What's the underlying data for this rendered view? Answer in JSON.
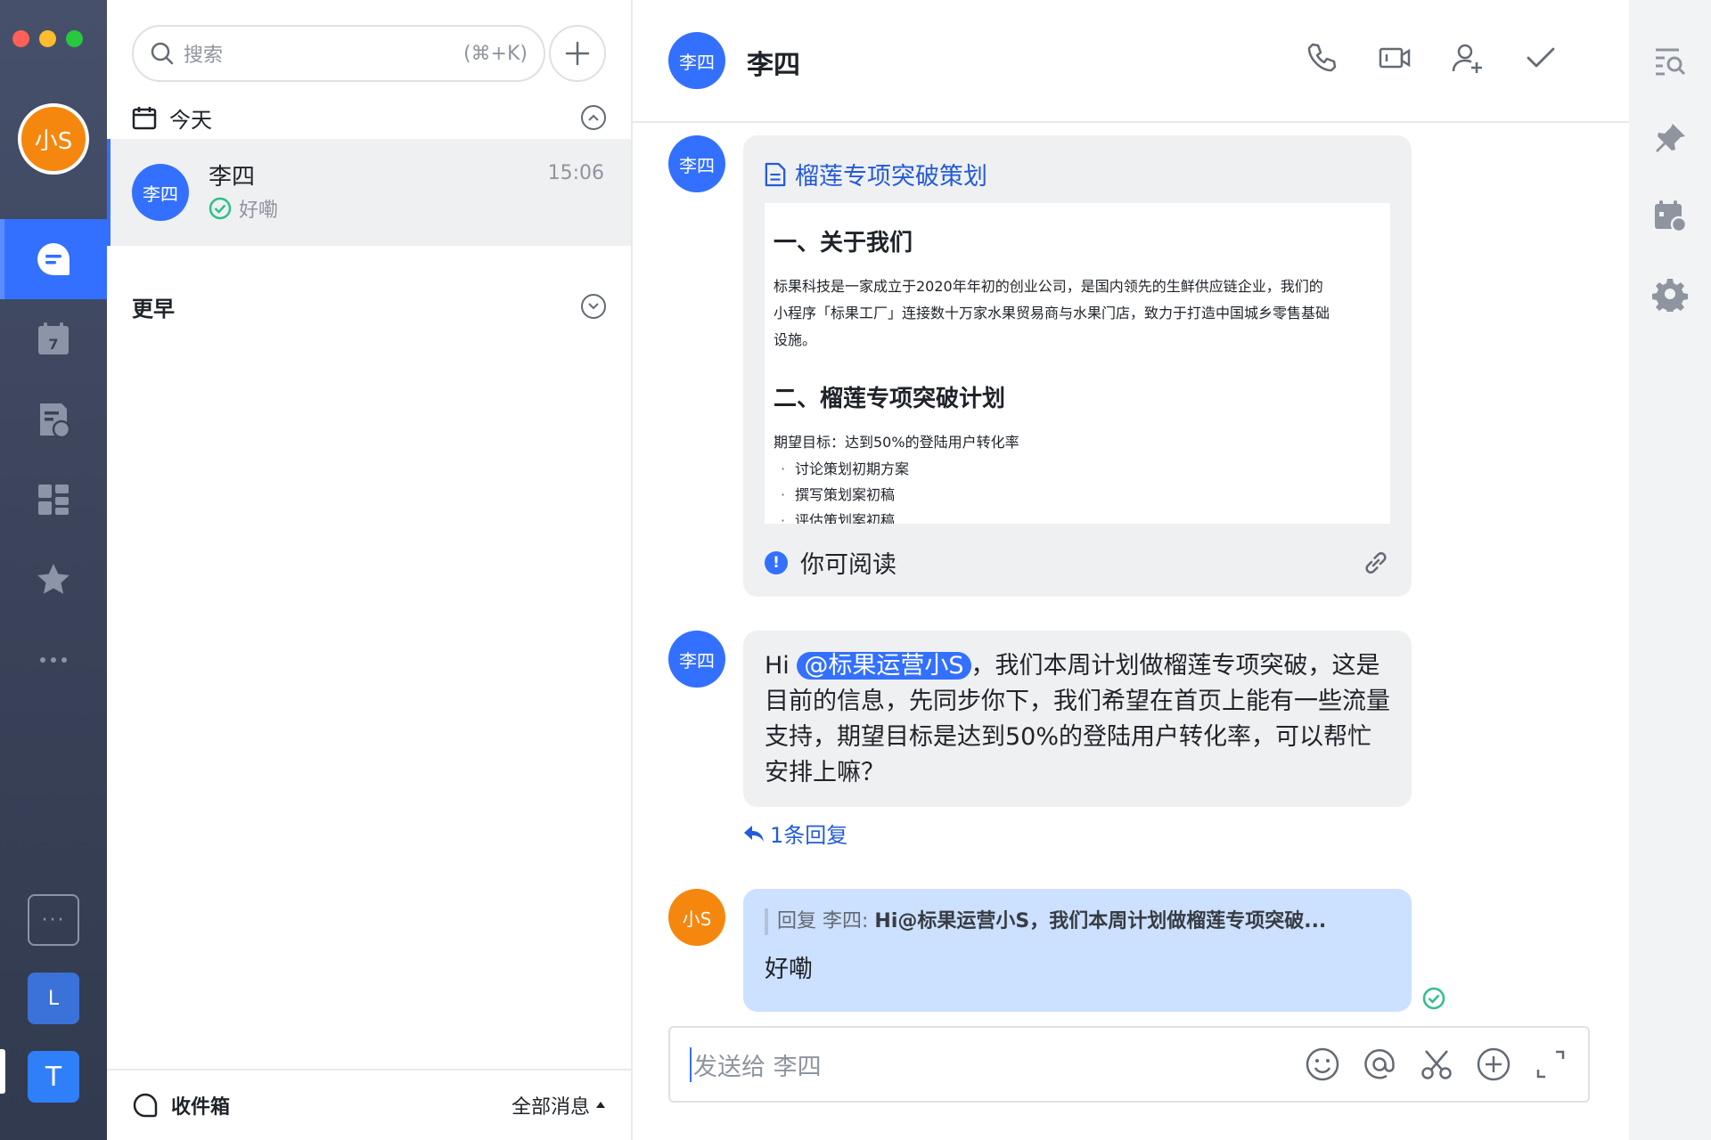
{
  "colors": {
    "accent": "#3370ff",
    "rail_bg": "#3a4259",
    "my_avatar": "#f5870f",
    "read_ok": "#2fbf8a"
  },
  "user": {
    "avatar_text": "小S"
  },
  "nav": {
    "items": [
      {
        "icon": "chat-icon",
        "active": true
      },
      {
        "icon": "calendar-icon",
        "badge": "7"
      },
      {
        "icon": "docs-icon"
      },
      {
        "icon": "apps-icon"
      },
      {
        "icon": "star-icon"
      },
      {
        "icon": "more-icon"
      }
    ],
    "workspaces": [
      {
        "label": "···"
      },
      {
        "label": "L"
      },
      {
        "label": "T"
      }
    ]
  },
  "list": {
    "search_placeholder": "搜索",
    "search_shortcut": "(⌘+K)",
    "today_label": "今天",
    "earlier_label": "更早",
    "conversation": {
      "avatar_text": "李四",
      "name": "李四",
      "time": "15:06",
      "preview": "好嘞"
    },
    "inbox_label": "收件箱",
    "filter_label": "全部消息"
  },
  "chat": {
    "avatar_text": "李四",
    "title": "李四",
    "doc": {
      "title": "榴莲专项突破策划",
      "h1": "一、关于我们",
      "p1_line1": "标果科技是一家成立于2020年年初的创业公司，是国内领先的生鲜供应链企业，我们的",
      "p1_line2": "小程序「标果工厂」连接数十万家水果贸易商与水果门店，致力于打造中国城乡零售基础",
      "p1_line3": "设施。",
      "h2": "二、榴莲专项突破计划",
      "goal": "期望目标：达到50%的登陆用户转化率",
      "bullets": [
        "讨论策划初期方案",
        "撰写策划案初稿",
        "评估策划案初稿"
      ],
      "permission": "你可阅读"
    },
    "message": {
      "prefix": "Hi ",
      "mention": "@标果运营小S",
      "body": "，我们本周计划做榴莲专项突破，这是目前的信息，先同步你下，我们希望在首页上能有一些流量支持，期望目标是达到50%的登陆用户转化率，可以帮忙安排上嘛？"
    },
    "reply_count": "1条回复",
    "my_reply": {
      "avatar_text": "小S",
      "quote_prefix": "回复 李四: ",
      "quote_text": "Hi@标果运营小S，我们本周计划做榴莲专项突破...",
      "text": "好嘞"
    },
    "composer_placeholder": "发送给 李四"
  }
}
